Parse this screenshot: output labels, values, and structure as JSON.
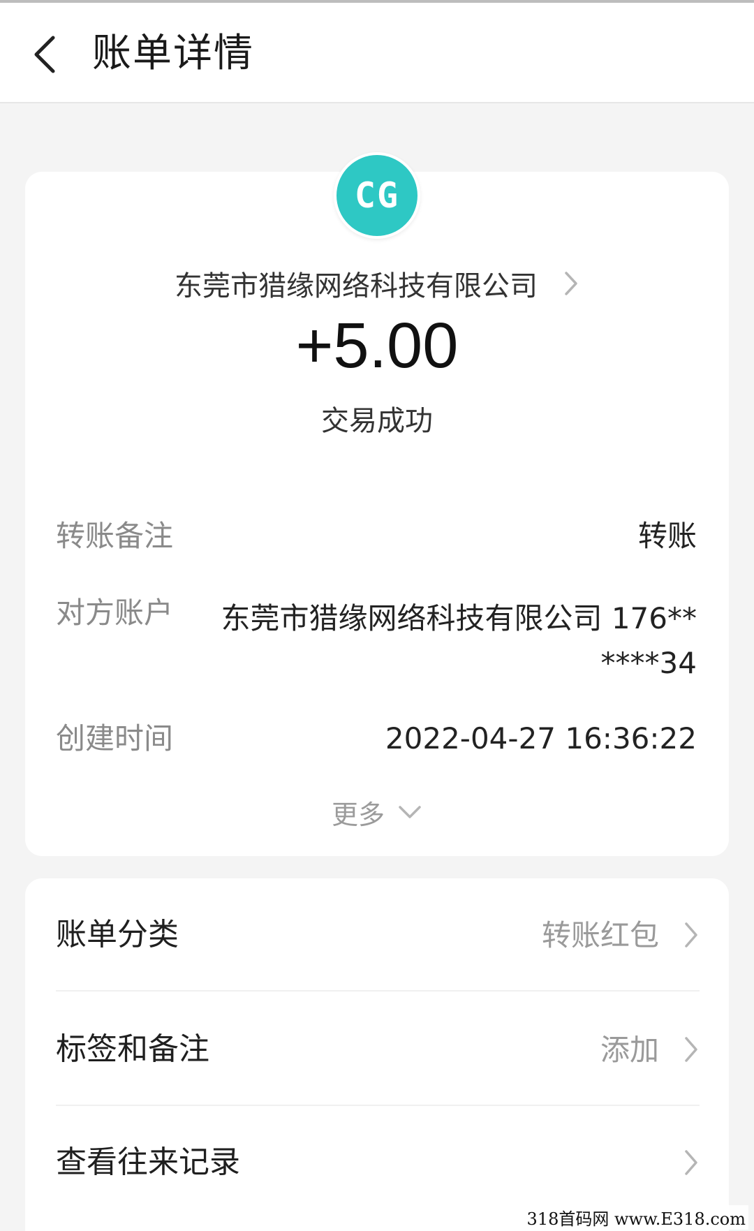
{
  "header": {
    "title": "账单详情"
  },
  "avatar": {
    "text": "CG",
    "color": "#2ec8c4"
  },
  "merchant": {
    "name": "东莞市猎缘网络科技有限公司"
  },
  "amount": "+5.00",
  "status": "交易成功",
  "details": {
    "note_label": "转账备注",
    "note_value": "转账",
    "account_label": "对方账户",
    "account_value": "东莞市猎缘网络科技有限公司 176** ****34",
    "time_label": "创建时间",
    "time_value": "2022-04-27 16:36:22"
  },
  "more": {
    "label": "更多"
  },
  "options": [
    {
      "label": "账单分类",
      "value": "转账红包"
    },
    {
      "label": "标签和备注",
      "value": "添加"
    },
    {
      "label": "查看往来记录",
      "value": ""
    }
  ],
  "watermark": "318首码网 www.E318.com"
}
